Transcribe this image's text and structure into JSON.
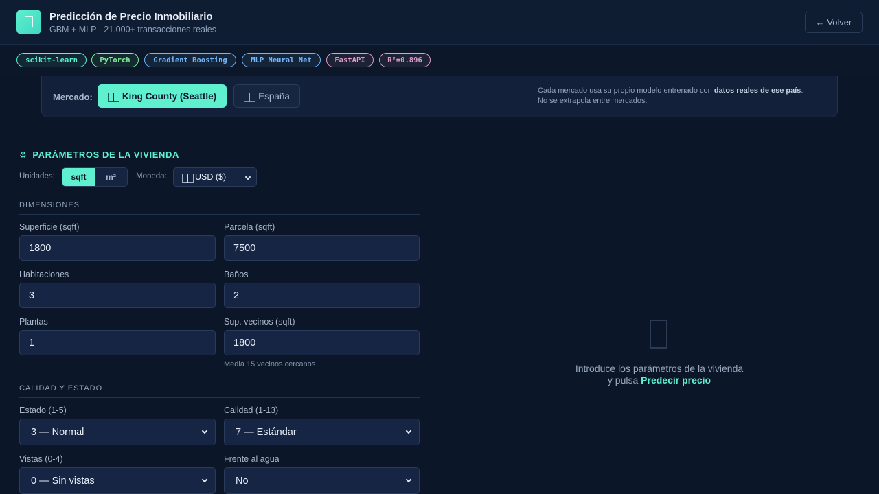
{
  "header": {
    "title": "Predicción de Precio Inmobiliario",
    "subtitle": "GBM + MLP · 21.000+ transacciones reales",
    "back_label": "← Volver"
  },
  "tags": [
    {
      "label": "scikit-learn",
      "color": "#5ef0cf"
    },
    {
      "label": "PyTorch",
      "color": "#7ef09a"
    },
    {
      "label": "Gradient Boosting",
      "color": "#6fb6ff"
    },
    {
      "label": "MLP Neural Net",
      "color": "#6fb6ff"
    },
    {
      "label": "FastAPI",
      "color": "#e29ad2"
    },
    {
      "label": "R²=0.896",
      "color": "#e29ad2"
    }
  ],
  "market": {
    "label": "Mercado:",
    "options": [
      {
        "label": "King County (Seattle)",
        "active": true
      },
      {
        "label": "España",
        "active": false
      }
    ],
    "note_prefix": "Cada mercado usa su propio modelo entrenado con ",
    "note_bold": "datos reales de ese país",
    "note_suffix": ".",
    "note_line2": "No se extrapola entre mercados."
  },
  "params": {
    "section_title": "PARÁMETROS DE LA VIVIENDA",
    "units_label": "Unidades:",
    "units": [
      "sqft",
      "m²"
    ],
    "units_selected": "sqft",
    "currency_label": "Moneda:",
    "currency_value": "USD ($)"
  },
  "dimensions": {
    "title": "DIMENSIONES",
    "fields": {
      "surface": {
        "label": "Superficie (sqft)",
        "value": "1800"
      },
      "lot": {
        "label": "Parcela (sqft)",
        "value": "7500"
      },
      "bedrooms": {
        "label": "Habitaciones",
        "value": "3"
      },
      "bathrooms": {
        "label": "Baños",
        "value": "2"
      },
      "floors": {
        "label": "Plantas",
        "value": "1"
      },
      "neighbors": {
        "label": "Sup. vecinos (sqft)",
        "value": "1800"
      }
    },
    "neighbors_hint": "Media 15 vecinos cercanos"
  },
  "quality": {
    "title": "CALIDAD Y ESTADO",
    "fields": {
      "condition": {
        "label": "Estado (1-5)",
        "value": "3 — Normal"
      },
      "grade": {
        "label": "Calidad (1-13)",
        "value": "7 — Estándar"
      },
      "view": {
        "label": "Vistas (0-4)",
        "value": "0 — Sin vistas"
      },
      "waterfront": {
        "label": "Frente al agua",
        "value": "No"
      }
    }
  },
  "result": {
    "line1": "Introduce los parámetros de la vivienda",
    "line2_prefix": "y pulsa ",
    "line2_bold": "Predecir precio"
  }
}
